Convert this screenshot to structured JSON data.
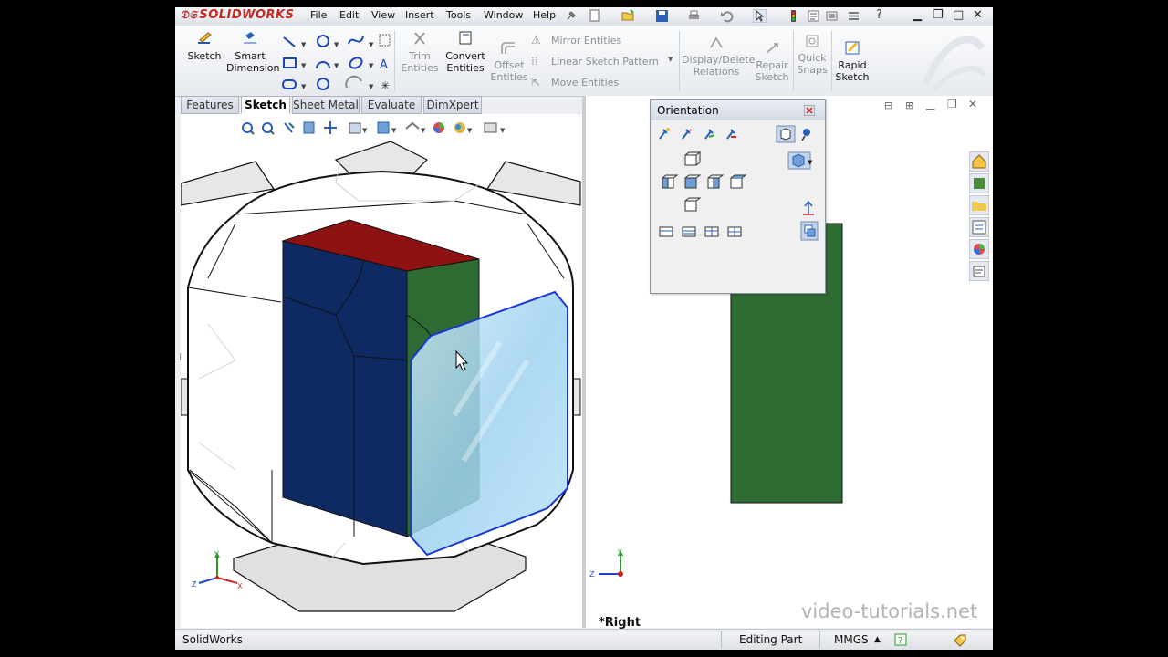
{
  "app": {
    "logo_text": "SOLIDWORKS",
    "brand_color": "#c8281e"
  },
  "menu": [
    "File",
    "Edit",
    "View",
    "Insert",
    "Tools",
    "Window",
    "Help"
  ],
  "ribbon": {
    "sketch": "Sketch",
    "smart_dimension": [
      "Smart",
      "Dimension"
    ],
    "trim_entities": [
      "Trim",
      "Entities"
    ],
    "convert_entities": [
      "Convert",
      "Entities"
    ],
    "offset_entities": [
      "Offset",
      "Entities"
    ],
    "mirror_entities": "Mirror Entities",
    "linear_sketch_pattern": "Linear Sketch Pattern",
    "move_entities": "Move Entities",
    "display_delete_relations": [
      "Display/Delete",
      "Relations"
    ],
    "repair_sketch": [
      "Repair",
      "Sketch"
    ],
    "quick_snaps": [
      "Quick",
      "Snaps"
    ],
    "rapid_sketch": [
      "Rapid",
      "Sketch"
    ]
  },
  "tabs": [
    "Features",
    "Sketch",
    "Sheet Metal",
    "Evaluate",
    "DimXpert"
  ],
  "active_tab": "Sketch",
  "orientation_panel": {
    "title": "Orientation"
  },
  "right_view": {
    "view_name": "*Right",
    "watermark": "video-tutorials.net"
  },
  "triad": {
    "y": "Y",
    "z": "Z",
    "x": "X"
  },
  "status": {
    "app_name": "SolidWorks",
    "mode": "Editing Part",
    "units": "MMGS"
  },
  "colors": {
    "top_face": "#8e1212",
    "front_face": "#0f2a63",
    "side_face": "#2e6b33",
    "highlight_face": "#a9d8f2",
    "selection_edge": "#1a36d6"
  }
}
